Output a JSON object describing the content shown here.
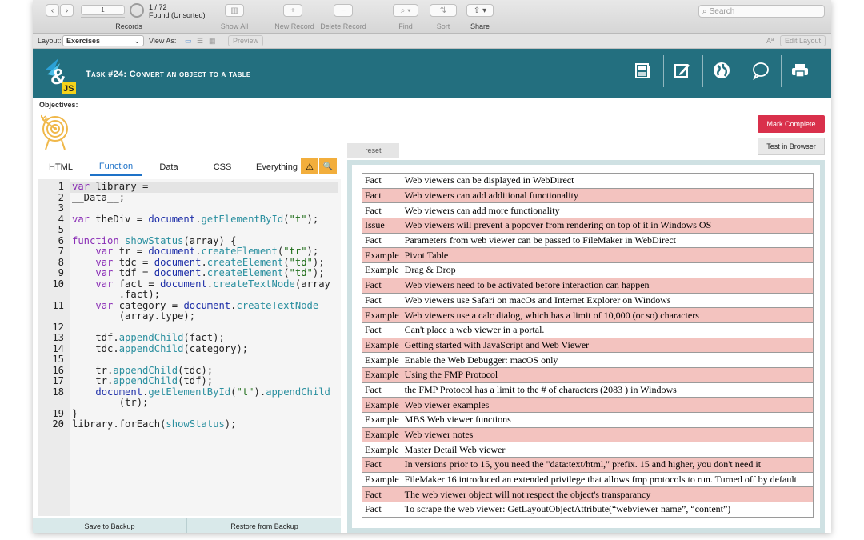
{
  "toolbar": {
    "record_counter": "1",
    "record_total": "1 / 72",
    "found_label": "Found (Unsorted)",
    "records_label": "Records",
    "show_all_label": "Show All",
    "new_record_label": "New Record",
    "delete_record_label": "Delete Record",
    "find_label": "Find",
    "sort_label": "Sort",
    "share_label": "Share",
    "search_placeholder": "Search"
  },
  "layoutbar": {
    "layout_label": "Layout:",
    "layout_value": "Exercises",
    "view_as_label": "View As:",
    "preview_label": "Preview",
    "edit_layout_label": "Edit Layout",
    "font_icon_label": "Aª"
  },
  "header": {
    "logo_text": "JS",
    "task_title": "Task #24: Convert an object to a table",
    "icons": [
      "document-icon",
      "edit-icon",
      "globe-icon",
      "chat-icon",
      "print-icon"
    ]
  },
  "content": {
    "objectives_label": "Objectives:",
    "mark_complete": "Mark Complete",
    "test_in_browser": "Test in Browser",
    "reset": "reset"
  },
  "tabs": [
    {
      "label": "HTML"
    },
    {
      "label": "Function",
      "active": true
    },
    {
      "label": "Data"
    },
    {
      "label": "CSS"
    },
    {
      "label": "Everything"
    }
  ],
  "tab_icons": {
    "warning": "⚠",
    "search": "🔍"
  },
  "code": {
    "line_numbers": [
      "1",
      "2",
      "3",
      "4",
      "5",
      "6",
      "7",
      "8",
      "9",
      "10",
      "",
      "11",
      "",
      "12",
      "13",
      "14",
      "15",
      "16",
      "17",
      "18",
      "",
      "19",
      "20"
    ],
    "lines": [
      "var library =",
      "__Data__;",
      "",
      "var theDiv = document.getElementById(\"t\");",
      "",
      "function showStatus(array) {",
      "    var tr = document.createElement(\"tr\");",
      "    var tdc = document.createElement(\"td\");",
      "    var tdf = document.createElement(\"td\");",
      "    var fact = document.createTextNode(array",
      "        .fact);",
      "    var category = document.createTextNode",
      "        (array.type);",
      "",
      "    tdf.appendChild(fact);",
      "    tdc.appendChild(category);",
      "",
      "    tr.appendChild(tdc);",
      "    tr.appendChild(tdf);",
      "    document.getElementById(\"t\").appendChild",
      "        (tr);",
      "}",
      "library.forEach(showStatus);"
    ]
  },
  "bottom": {
    "save_to_backup": "Save to Backup",
    "restore_from_backup": "Restore from Backup"
  },
  "colors": {
    "header_teal": "#236f7f",
    "mark_complete_red": "#d9304b",
    "row_pink": "#f3c3bf",
    "tab_active_blue": "#1e72c8",
    "warning_orange": "#f2ae3c"
  },
  "table": {
    "rows": [
      {
        "type": "Fact",
        "fact": "Web viewers can be displayed in WebDirect",
        "pink": false
      },
      {
        "type": "Fact",
        "fact": "Web viewers can add additional functionality",
        "pink": true
      },
      {
        "type": "Fact",
        "fact": "Web viewers can add more functionality",
        "pink": false
      },
      {
        "type": "Issue",
        "fact": "Web viewers will prevent a popover from rendering on top of it in Windows OS",
        "pink": true
      },
      {
        "type": "Fact",
        "fact": "Parameters from web viewer can be passed to FileMaker in WebDirect",
        "pink": false
      },
      {
        "type": "Example",
        "fact": "Pivot Table",
        "pink": true
      },
      {
        "type": "Example",
        "fact": "Drag & Drop",
        "pink": false
      },
      {
        "type": "Fact",
        "fact": "Web viewers need to be activated before interaction can happen",
        "pink": true
      },
      {
        "type": "Fact",
        "fact": "Web viewers use Safari on macOs and Internet Explorer on Windows",
        "pink": false
      },
      {
        "type": "Example",
        "fact": "Web viewers use a calc dialog, which has a limit of 10,000 (or so) characters",
        "pink": true
      },
      {
        "type": "Fact",
        "fact": "Can't place a web viewer in a portal.",
        "pink": false
      },
      {
        "type": "Example",
        "fact": "Getting started with JavaScript and Web Viewer",
        "pink": true
      },
      {
        "type": "Example",
        "fact": "Enable the Web Debugger: macOS only",
        "pink": false
      },
      {
        "type": "Example",
        "fact": "Using the FMP Protocol",
        "pink": true
      },
      {
        "type": "Fact",
        "fact": "the FMP Protocol has a limit to the # of characters (2083 ) in Windows",
        "pink": false
      },
      {
        "type": "Example",
        "fact": "Web viewer examples",
        "pink": true
      },
      {
        "type": "Example",
        "fact": "MBS Web viewer functions",
        "pink": false
      },
      {
        "type": "Example",
        "fact": "Web viewer notes",
        "pink": true
      },
      {
        "type": "Example",
        "fact": "Master Detail Web viewer",
        "pink": false
      },
      {
        "type": "Fact",
        "fact": "In versions prior to 15, you need the \"data:text/html,\" prefix. 15 and higher, you don't need it",
        "pink": true
      },
      {
        "type": "Example",
        "fact": "FileMaker 16 introduced an extended privilege that allows fmp protocols to run. Turned off by default",
        "pink": false
      },
      {
        "type": "Fact",
        "fact": "The web viewer object will not respect the object's transparancy",
        "pink": true
      },
      {
        "type": "Fact",
        "fact": "To scrape the web viewer: GetLayoutObjectAttribute(“webviewer name”, “content”)",
        "pink": false
      }
    ]
  }
}
